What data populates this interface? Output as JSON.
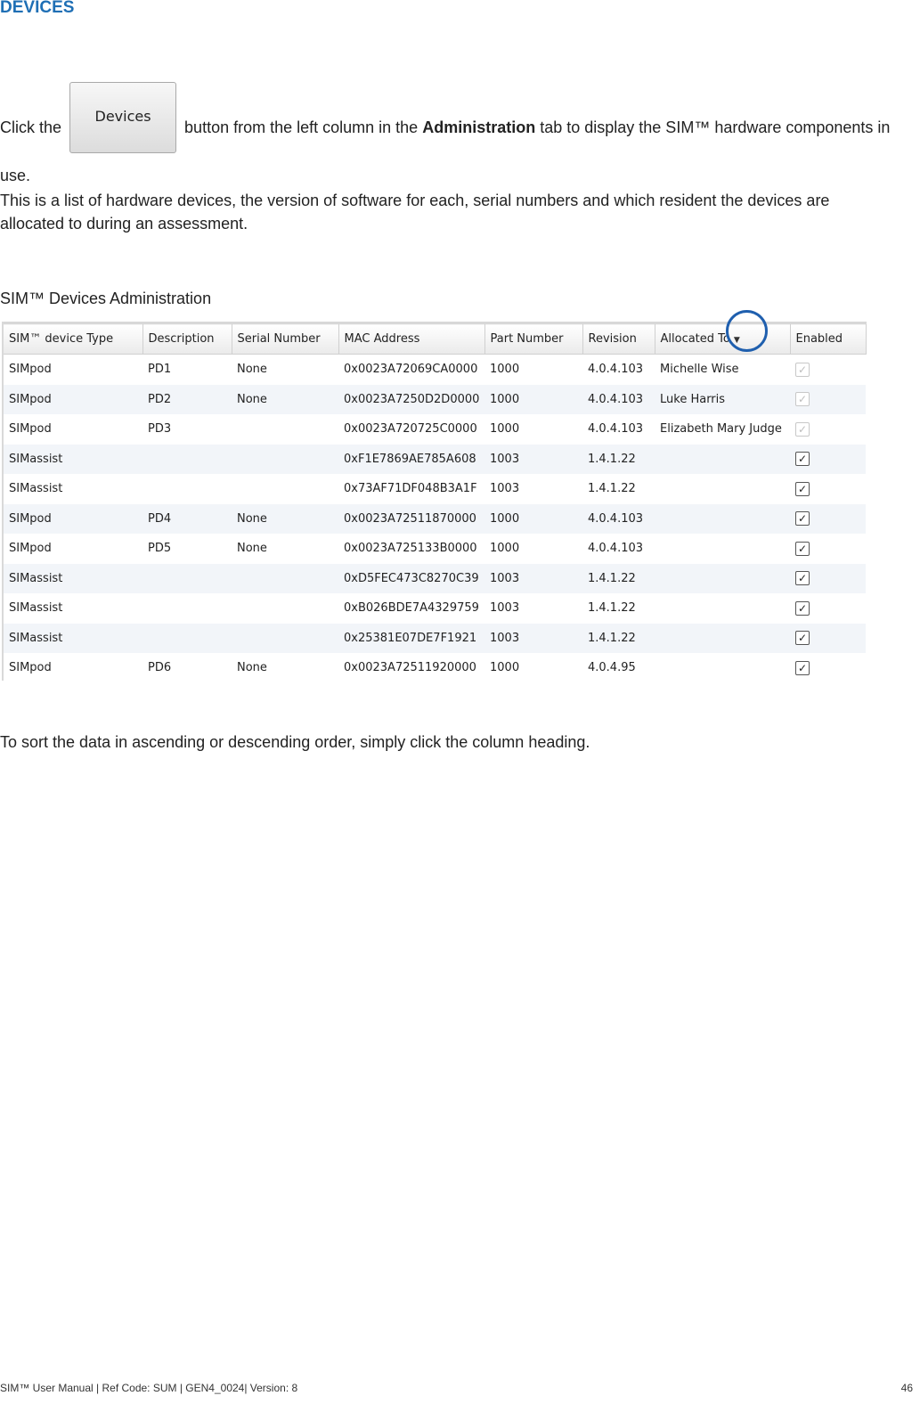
{
  "heading": "DEVICES",
  "intro": {
    "before": "Click the",
    "button_label": "Devices",
    "middle": " button from the left column in the ",
    "bold": "Administration",
    "after": " tab to display the SIM™ hardware components in use."
  },
  "description": "This is a list of hardware devices, the version of software for each, serial numbers and which resident the devices are allocated to during an assessment.",
  "caption": "SIM™ Devices Administration",
  "table": {
    "columns": [
      "SIM™ device Type",
      "Description",
      "Serial Number",
      "MAC Address",
      "Part Number",
      "Revision",
      "Allocated To",
      "Enabled"
    ],
    "rows": [
      [
        "SIMpod",
        "PD1",
        "None",
        "0x0023A72069CA0000",
        "1000",
        "4.0.4.103",
        "Michelle Wise",
        "dim"
      ],
      [
        "SIMpod",
        "PD2",
        "None",
        "0x0023A7250D2D0000",
        "1000",
        "4.0.4.103",
        "Luke Harris",
        "dim"
      ],
      [
        "SIMpod",
        "PD3",
        "",
        "0x0023A720725C0000",
        "1000",
        "4.0.4.103",
        "Elizabeth Mary Judge",
        "dim"
      ],
      [
        "SIMassist",
        "",
        "",
        "0xF1E7869AE785A608",
        "1003",
        "1.4.1.22",
        "",
        "on"
      ],
      [
        "SIMassist",
        "",
        "",
        "0x73AF71DF048B3A1F",
        "1003",
        "1.4.1.22",
        "",
        "on"
      ],
      [
        "SIMpod",
        "PD4",
        "None",
        "0x0023A72511870000",
        "1000",
        "4.0.4.103",
        "",
        "on"
      ],
      [
        "SIMpod",
        "PD5",
        "None",
        "0x0023A725133B0000",
        "1000",
        "4.0.4.103",
        "",
        "on"
      ],
      [
        "SIMassist",
        "",
        "",
        "0xD5FEC473C8270C39",
        "1003",
        "1.4.1.22",
        "",
        "on"
      ],
      [
        "SIMassist",
        "",
        "",
        "0xB026BDE7A4329759",
        "1003",
        "1.4.1.22",
        "",
        "on"
      ],
      [
        "SIMassist",
        "",
        "",
        "0x25381E07DE7F1921",
        "1003",
        "1.4.1.22",
        "",
        "on"
      ],
      [
        "SIMpod",
        "PD6",
        "None",
        "0x0023A72511920000",
        "1000",
        "4.0.4.95",
        "",
        "on"
      ]
    ]
  },
  "sort_note": "To sort the data in ascending or descending order, simply click the column heading.",
  "footer": {
    "left": "SIM™ User Manual | Ref Code: SUM | GEN4_0024| Version: 8",
    "page": "46"
  },
  "colors": {
    "heading": "#1f6fb5",
    "highlight_circle": "#1f5fae",
    "alt_row": "#f2f5f9"
  }
}
